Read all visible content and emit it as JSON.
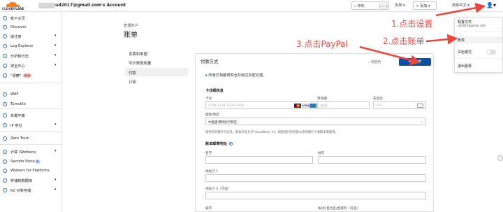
{
  "header": {
    "logo_text": "CLOUDFLARE",
    "account_name": "ud2017@gmail.com's Account",
    "search_label": "转到..",
    "search_shortcut": "Ctrl+K",
    "support_label": "支持",
    "add_label": "+ 添加",
    "language_label": "简体中文",
    "brand_color": "#f38020"
  },
  "sidebar": {
    "items": [
      {
        "label": "帐户主页",
        "icon": "home-icon"
      },
      {
        "label": "Discover",
        "icon": "compass-icon"
      },
      {
        "label": "域注册",
        "icon": "globe-icon",
        "expand": "▾"
      },
      {
        "label": "Log Explorer",
        "icon": "log-icon",
        "expand": "▾"
      },
      {
        "label": "分析和日志",
        "icon": "chart-icon",
        "expand": "▾"
      },
      {
        "label": "安全中心",
        "icon": "shield-icon",
        "expand": "▾"
      },
      {
        "label": "\"洞察\"",
        "icon": "lightbulb-icon",
        "badge": "Beta"
      },
      {
        "label": "WAF",
        "icon": "waf-icon"
      },
      {
        "label": "Turnstile",
        "icon": "turnstile-icon"
      },
      {
        "label": "负载平衡",
        "icon": "load-balancer-icon"
      },
      {
        "label": "IP 地址",
        "icon": "ip-icon",
        "expand": "▾"
      },
      {
        "label": "Zero Trust",
        "icon": "zero-trust-icon"
      },
      {
        "label": "计算 (Workers)",
        "icon": "workers-icon",
        "expand": "▾"
      },
      {
        "label": "Secrets Store",
        "icon": "key-icon",
        "badge": "新"
      },
      {
        "label": "Workers for Platforms",
        "icon": "platforms-icon"
      },
      {
        "label": "存储和数据库",
        "icon": "database-icon",
        "expand": "▾"
      },
      {
        "label": "R2 对象存储",
        "icon": "bucket-icon",
        "expand": "▾"
      }
    ]
  },
  "main": {
    "breadcrumb": "管理帐户",
    "title": "账单",
    "tabs": [
      {
        "label": "发票和单据"
      },
      {
        "label": "可计费使用量"
      },
      {
        "label": "付款"
      },
      {
        "label": "订阅"
      }
    ]
  },
  "payment": {
    "title": "付款方式",
    "or_use": "或使用",
    "paypal_label": "PayPal",
    "secure_note": "所有交易都很安全并经过加密处理。",
    "card_section": "卡详细信息",
    "card_number_label": "卡号",
    "card_number_placeholder": "1234 1234 1234 1234",
    "expiry_label": "有效期",
    "expiry_placeholder": "月/年",
    "cvc_label": "安全码",
    "cvc_placeholder": "CVC",
    "country_label": "国家/地区",
    "country_value": "中国香港特别行政区",
    "info_text": "提供您的银行卡信息，即表示您允许 Cloudflare, Inc. 按照他们的条款从您的银行卡收取未来款项。",
    "billing_section": "账单邮寄地址",
    "first_name_label": "名字",
    "last_name_label": "姓氏",
    "address1_label": "地址行 1",
    "address2_label": "地址行 2（可选）",
    "city_label": "城市",
    "state_label": "省/州/自治区/直辖市（可选）"
  },
  "user_menu": {
    "profile": "配置文件",
    "email": "ud2017@gmail.com",
    "billing": "账单",
    "dark_mode": "深色模式",
    "logout": "退出登录"
  },
  "annotations": {
    "step1": "1.点击设置",
    "step2": "2.点击账单",
    "step3": "3.点击PayPal",
    "color": "#e8473f"
  }
}
